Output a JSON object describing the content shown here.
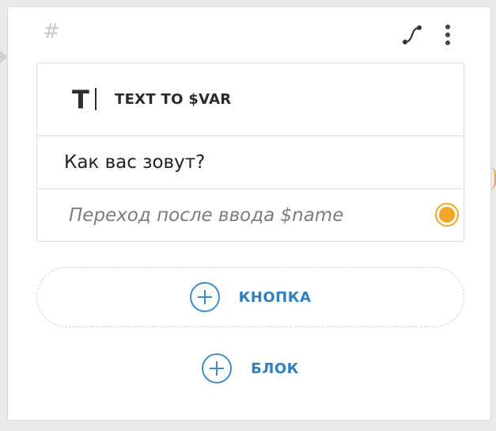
{
  "block": {
    "hash_symbol": "#",
    "type_icon": "text-cursor-icon",
    "type_glyph": "T",
    "title": "TEXT TO $VAR",
    "question": "Как вас зовут?",
    "transition": "Переход после ввода $name"
  },
  "actions": {
    "add_button_label": "КНОПКА",
    "add_block_label": "БЛОК"
  },
  "colors": {
    "accent_orange": "#f5a623",
    "link_blue": "#2f7fc1",
    "border": "#dedede"
  }
}
